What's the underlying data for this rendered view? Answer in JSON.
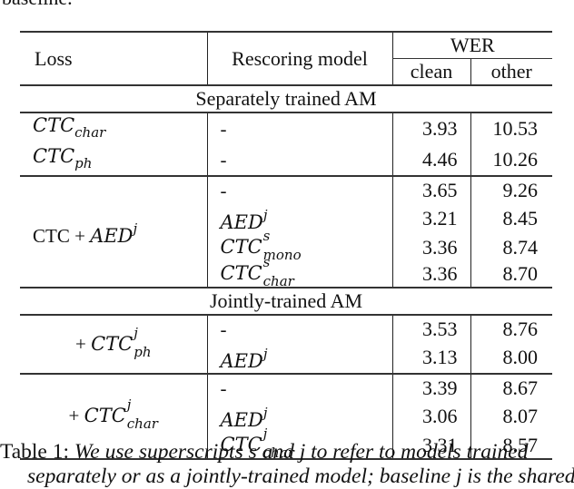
{
  "preceding_text": "baseline.",
  "table": {
    "headers": {
      "loss": "Loss",
      "rescoring_model": "Rescoring model",
      "wer": "WER",
      "clean": "clean",
      "other": "other"
    },
    "sections": [
      {
        "title": "Separately trained AM",
        "groups": [
          {
            "loss": {
              "base": "CTC",
              "sub": "char",
              "sup": ""
            },
            "rows": [
              {
                "rescoring": {
                  "base": "-",
                  "sub": "",
                  "sup": ""
                },
                "clean": "3.93",
                "other": "10.53"
              }
            ]
          },
          {
            "loss": {
              "base": "CTC",
              "sub": "ph",
              "sup": ""
            },
            "rows": [
              {
                "rescoring": {
                  "base": "-",
                  "sub": "",
                  "sup": ""
                },
                "clean": "4.46",
                "other": "10.26"
              }
            ]
          },
          {
            "loss": {
              "prefix": "CTC + ",
              "base": "AED",
              "sub": "",
              "sup": "j"
            },
            "rows": [
              {
                "rescoring": {
                  "base": "-",
                  "sub": "",
                  "sup": ""
                },
                "clean": "3.65",
                "other": "9.26"
              },
              {
                "rescoring": {
                  "base": "AED",
                  "sub": "",
                  "sup": "j"
                },
                "clean": "3.21",
                "other": "8.45"
              },
              {
                "rescoring": {
                  "base": "CTC",
                  "sub": "mono",
                  "sup": "s"
                },
                "clean": "3.36",
                "other": "8.74"
              },
              {
                "rescoring": {
                  "base": "CTC",
                  "sub": "char",
                  "sup": "s"
                },
                "clean": "3.36",
                "other": "8.70"
              }
            ]
          }
        ]
      },
      {
        "title": "Jointly-trained AM",
        "groups": [
          {
            "loss": {
              "prefix": "+ ",
              "base": "CTC",
              "sub": "ph",
              "sup": "j"
            },
            "rows": [
              {
                "rescoring": {
                  "base": "-",
                  "sub": "",
                  "sup": ""
                },
                "clean": "3.53",
                "other": "8.76"
              },
              {
                "rescoring": {
                  "base": "AED",
                  "sub": "",
                  "sup": "j"
                },
                "clean": "3.13",
                "other": "8.00"
              }
            ]
          },
          {
            "loss": {
              "prefix": "+ ",
              "base": "CTC",
              "sub": "char",
              "sup": "j"
            },
            "rows": [
              {
                "rescoring": {
                  "base": "-",
                  "sub": "",
                  "sup": ""
                },
                "clean": "3.39",
                "other": "8.67"
              },
              {
                "rescoring": {
                  "base": "AED",
                  "sub": "",
                  "sup": "j"
                },
                "clean": "3.06",
                "other": "8.07"
              },
              {
                "rescoring": {
                  "base": "CTC",
                  "sub": "char",
                  "sup": "j"
                },
                "clean": "3.31",
                "other": "8.57"
              }
            ]
          }
        ]
      }
    ]
  },
  "caption": {
    "label": "Table 1:",
    "text": "We use superscripts s and j to refer to models trained",
    "continuation": "separately or as a jointly-trained model; baseline j is the shared"
  }
}
